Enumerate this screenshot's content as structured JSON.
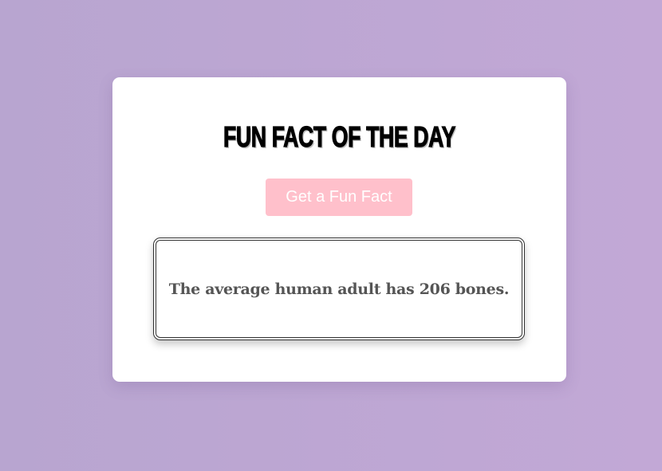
{
  "card": {
    "title": "FUN FACT OF THE DAY",
    "button_label": "Get a Fun Fact",
    "fact": "The average human adult has 206 bones."
  },
  "colors": {
    "background_start": "#b8a5d0",
    "background_end": "#c2a8d6",
    "button_bg": "#ffc0cb",
    "button_text": "#ffffff",
    "fact_text": "#555555"
  }
}
